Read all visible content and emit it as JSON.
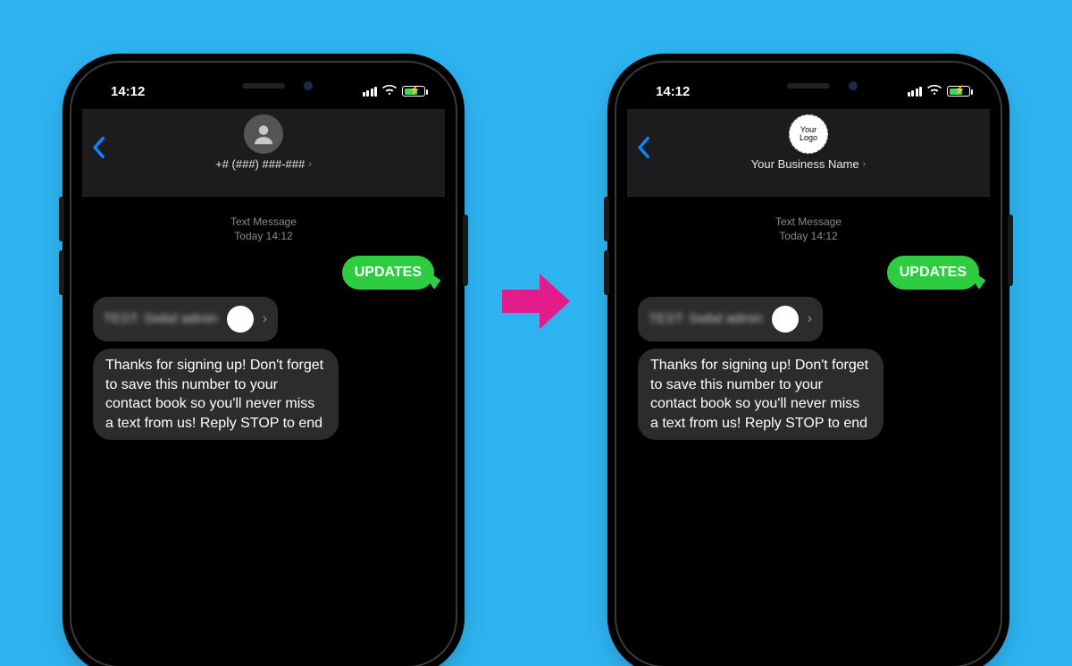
{
  "status": {
    "time": "14:12"
  },
  "timestamp": {
    "label": "Text Message",
    "when": "Today 14:12"
  },
  "outgoing": {
    "text": "UPDATES"
  },
  "link_preview": {
    "blurred_text": "TEST: Swbd admin"
  },
  "incoming": {
    "text": "Thanks for signing up! Don't forget to save this number to your contact book so you'll never miss a text from us! Reply STOP to end"
  },
  "left_phone": {
    "contact_name": "+# (###) ###-###"
  },
  "right_phone": {
    "contact_name": "Your Business Name",
    "logo_line1": "Your",
    "logo_line2": "Logo"
  }
}
